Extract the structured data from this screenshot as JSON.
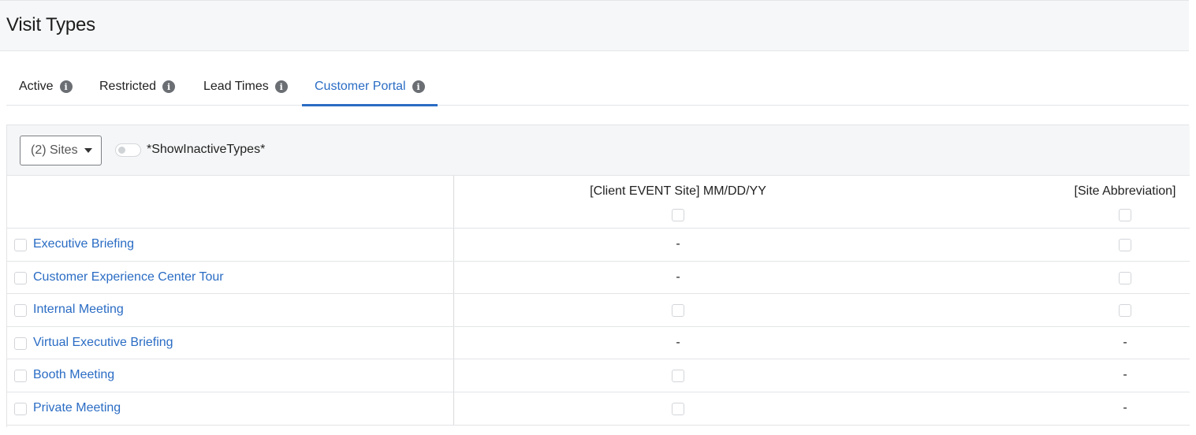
{
  "page": {
    "title": "Visit Types"
  },
  "tabs": [
    {
      "label": "Active",
      "active": false
    },
    {
      "label": "Restricted",
      "active": false
    },
    {
      "label": "Lead Times",
      "active": false
    },
    {
      "label": "Customer Portal",
      "active": true
    }
  ],
  "tab_info_glyph": "i",
  "toolbar": {
    "sites_label": "(2) Sites",
    "toggle_label": "*ShowInactiveTypes*",
    "toggle_on": false
  },
  "table": {
    "columns": [
      "[Client EVENT Site] MM/DD/YY",
      "[Site Abbreviation]"
    ],
    "rows": [
      {
        "name": "Executive Briefing",
        "cells": [
          "-",
          "checkbox"
        ]
      },
      {
        "name": "Customer Experience Center Tour",
        "cells": [
          "-",
          "checkbox"
        ]
      },
      {
        "name": "Internal Meeting",
        "cells": [
          "checkbox",
          "checkbox"
        ]
      },
      {
        "name": "Virtual Executive Briefing",
        "cells": [
          "-",
          "-"
        ]
      },
      {
        "name": "Booth Meeting",
        "cells": [
          "checkbox",
          "-"
        ]
      },
      {
        "name": "Private Meeting",
        "cells": [
          "checkbox",
          "-"
        ]
      }
    ]
  },
  "colors": {
    "accent": "#2a6cc4",
    "info_icon": "#6b6f74"
  }
}
